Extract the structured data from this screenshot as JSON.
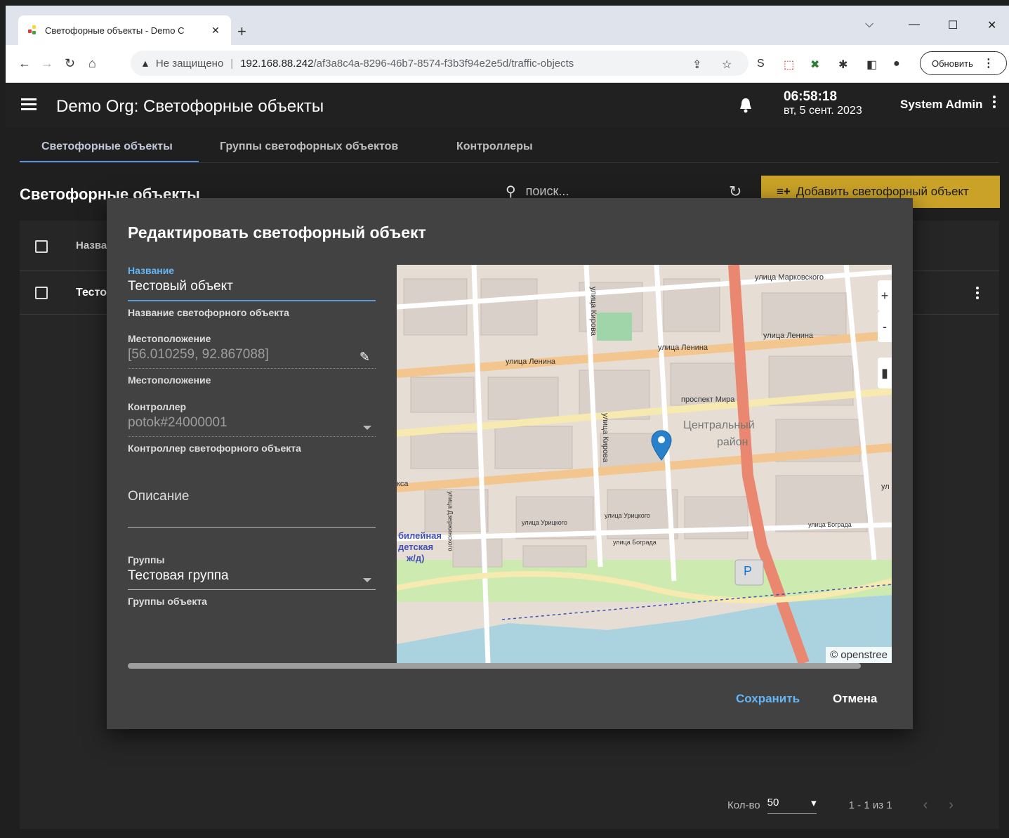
{
  "browser": {
    "tab_title": "Светофорные объекты - Demo С",
    "new_tab": "+",
    "not_secure": "Не защищено",
    "url_host": "192.168.88.242",
    "url_path": "/af3a8c4a-8296-46b7-8574-f3b3f94e2e5d/traffic-objects",
    "update_label": "Обновить"
  },
  "app": {
    "title": "Demo Org: Светофорные объекты",
    "time": "06:58:18",
    "date": "вт, 5 сент. 2023",
    "user": "System Admin",
    "tabs": [
      "Светофорные объекты",
      "Группы светофорных объектов",
      "Контроллеры"
    ],
    "page_heading": "Светофорные объекты",
    "search_placeholder": "поиск...",
    "add_button": "Добавить светофорный объект",
    "table": {
      "column_name": "Назва",
      "row_name": "Тесто"
    },
    "pager": {
      "label": "Кол-во",
      "size": "50",
      "range": "1 - 1 из 1"
    }
  },
  "dialog": {
    "title": "Редактировать светофорный объект",
    "name_label": "Название",
    "name_value": "Тестовый объект",
    "name_hint": "Название светофорного объекта",
    "location_label": "Местоположение",
    "location_value": "[56.010259, 92.867088]",
    "location_hint": "Местоположение",
    "controller_label": "Контроллер",
    "controller_value": "potok#24000001",
    "controller_hint": "Контроллер светофорного объекта",
    "description_placeholder": "Описание",
    "groups_label": "Группы",
    "groups_value": "Тестовая группа",
    "groups_hint": "Группы объекта",
    "save": "Сохранить",
    "cancel": "Отмена"
  },
  "map": {
    "labels": {
      "markovskogo": "улица Марковского",
      "lenina1": "улица Ленина",
      "lenina2": "улица Ленина",
      "lenina3": "улица Ленина",
      "mira": "проспект Мира",
      "central1": "Центральный",
      "central2": "район",
      "kirova1": "улица Кирова",
      "kirova2": "улица Кирова",
      "uritskogo1": "улица Урицкого",
      "uritskogo2": "улица Урицкого",
      "bograda1": "улица Бограда",
      "bograda2": "улица Бограда",
      "dzerzhinskogo": "улица Дзержинского",
      "kca": "кса",
      "ul": "ул",
      "park1": "билейная",
      "park2": "детская",
      "park3": "ж/д)",
      "parking": "P"
    },
    "attribution": "© openstree",
    "zoom_in": "+",
    "zoom_out": "-"
  },
  "colors": {
    "accent_yellow": "#c9a227",
    "link_blue": "#64b5f6",
    "road_orange": "#f3c58f",
    "highway_red": "#e98770",
    "water": "#aad3df"
  }
}
